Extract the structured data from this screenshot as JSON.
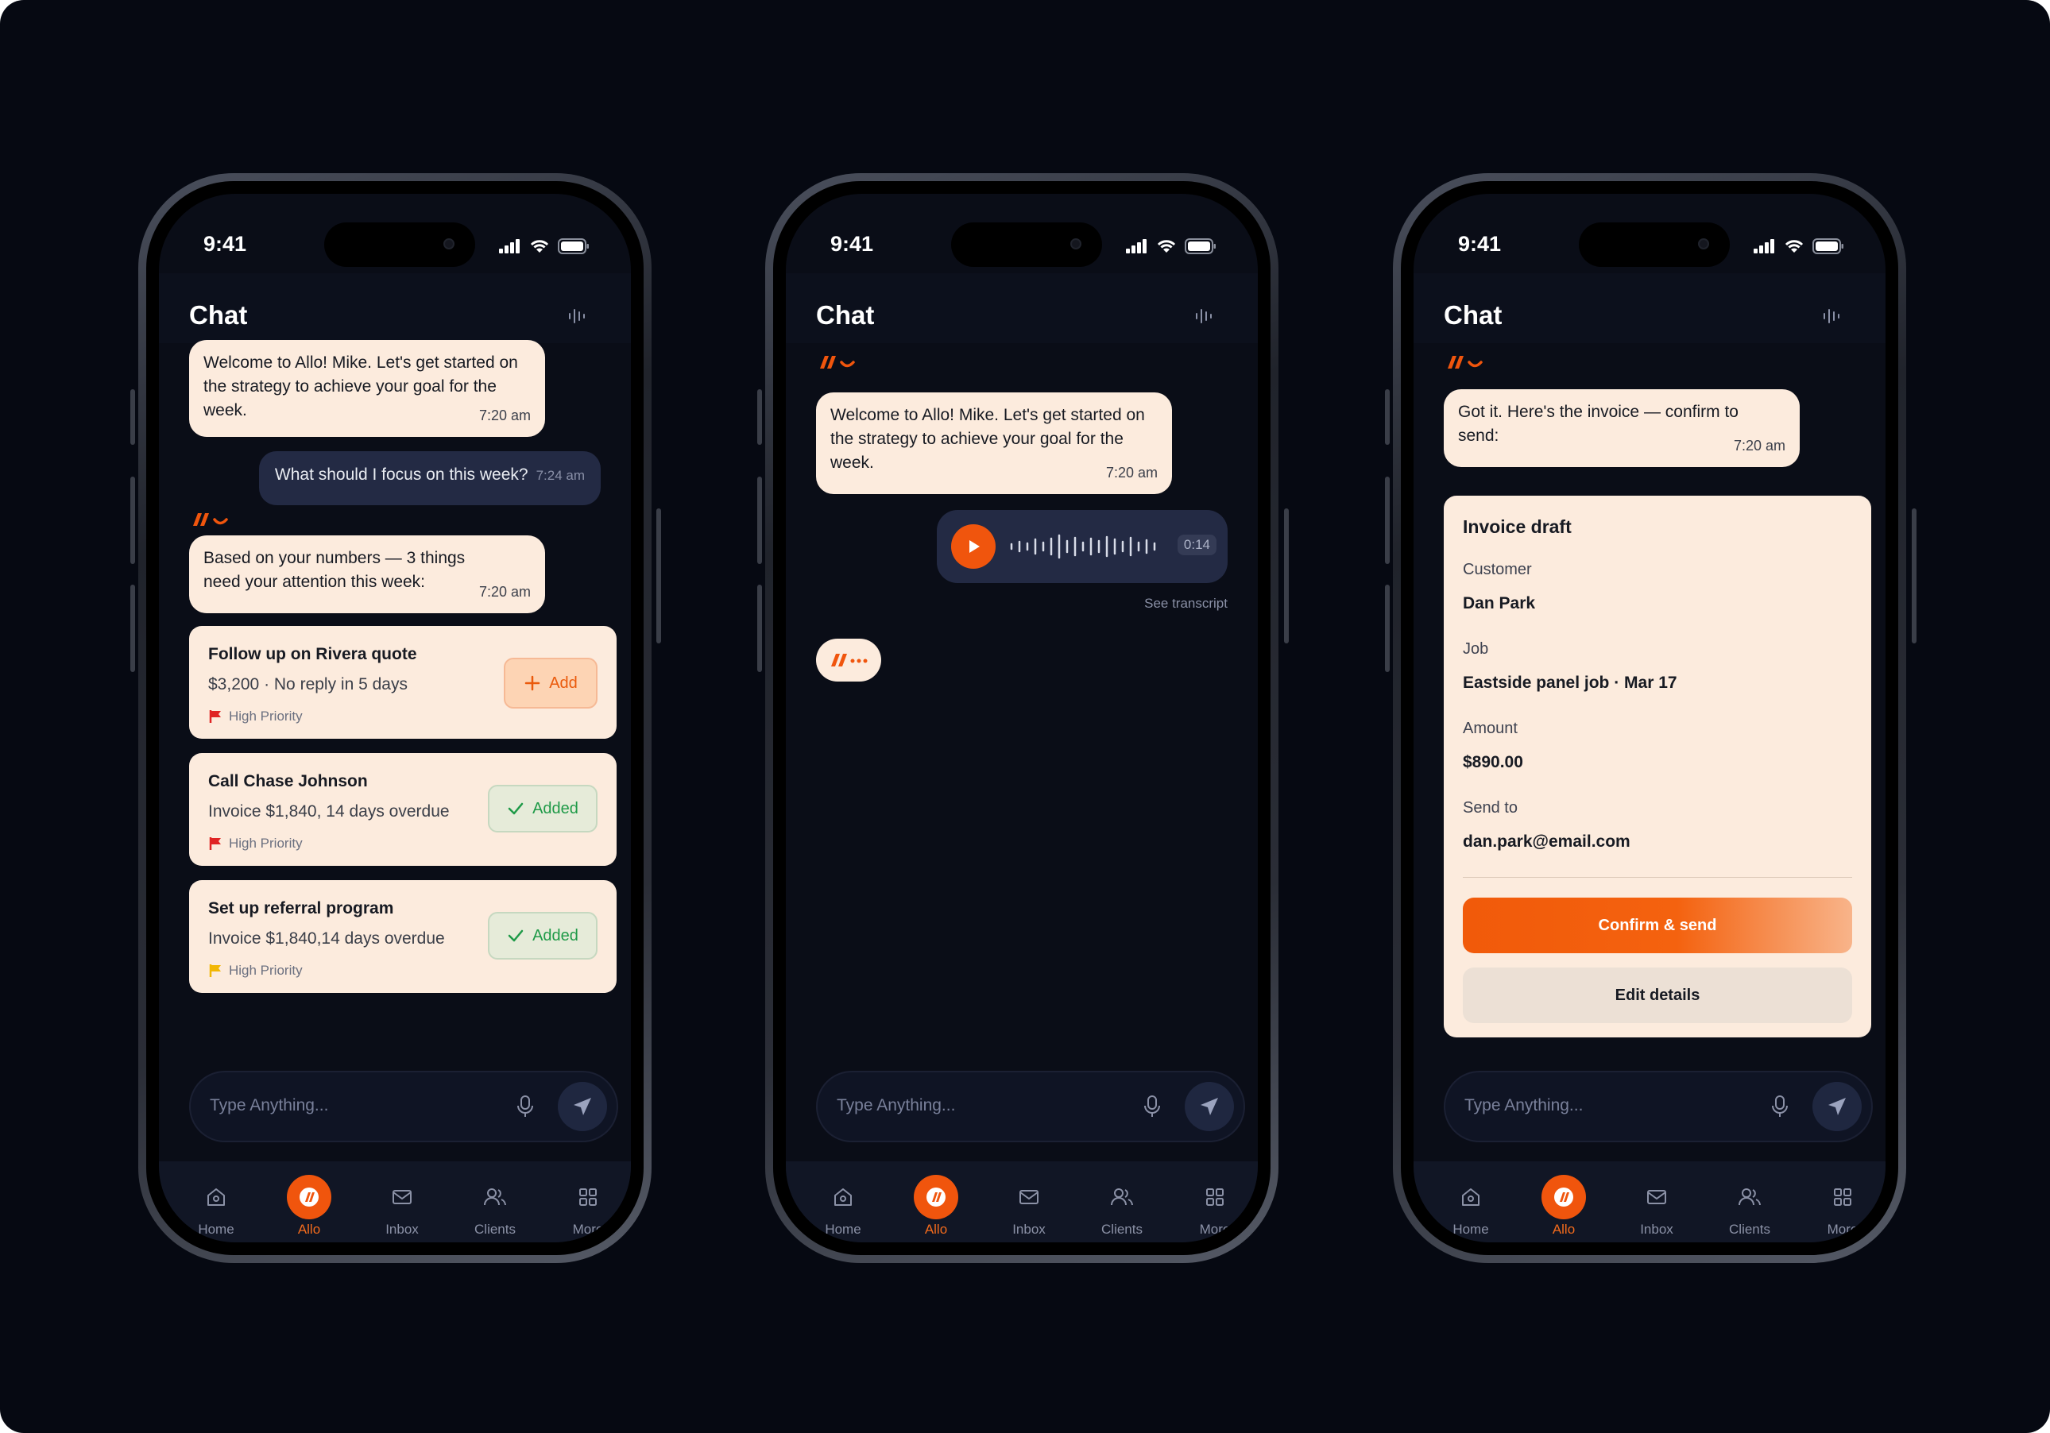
{
  "colors": {
    "accent": "#F0550D",
    "bubble": "#FCEBDD",
    "user_bubble": "#232A44",
    "background": "#060912",
    "added_green": "#1F9A48",
    "flag_red": "#E02424",
    "flag_yellow": "#F2B705"
  },
  "status": {
    "time": "9:41"
  },
  "header": {
    "title": "Chat"
  },
  "input": {
    "placeholder": "Type Anything..."
  },
  "tabs": [
    {
      "label": "Home",
      "icon": "home-icon"
    },
    {
      "label": "Allo",
      "icon": "allo-logo-icon"
    },
    {
      "label": "Inbox",
      "icon": "mail-icon"
    },
    {
      "label": "Clients",
      "icon": "users-icon"
    },
    {
      "label": "More",
      "icon": "grid-icon"
    }
  ],
  "screen1": {
    "welcome": {
      "text": "Welcome to Allo! Mike.  Let's get started on the strategy to achieve your goal for the week.",
      "time": "7:20 am"
    },
    "user_msg": {
      "text": "What should I focus on this week?",
      "time": "7:24 am"
    },
    "reply": {
      "text": "Based on your numbers — 3 things need your attention this week:",
      "time": "7:20 am"
    },
    "tasks": [
      {
        "title": "Follow up on Rivera quote",
        "subtitle": "$3,200 · No reply in 5 days",
        "priority": "High Priority",
        "flag": "red",
        "action": "Add",
        "added": false
      },
      {
        "title": "Call Chase Johnson",
        "subtitle": "Invoice $1,840, 14 days overdue",
        "priority": "High Priority",
        "flag": "red",
        "action": "Added",
        "added": true
      },
      {
        "title": "Set up referral program",
        "subtitle": "Invoice $1,840,14 days overdue",
        "priority": "High Priority",
        "flag": "yellow",
        "action": "Added",
        "added": true
      }
    ]
  },
  "screen2": {
    "welcome": {
      "text": "Welcome to Allo! Mike.  Let's get started on the strategy to achieve your goal for the week.",
      "time": "7:20 am"
    },
    "voice": {
      "duration": "0:14",
      "transcript_link": "See transcript"
    }
  },
  "screen3": {
    "reply": {
      "text": "Got it. Here's the invoice — confirm to send:",
      "time": "7:20 am"
    },
    "invoice": {
      "title": "Invoice draft",
      "customer_label": "Customer",
      "customer": "Dan Park",
      "job_label": "Job",
      "job": "Eastside panel job · Mar 17",
      "amount_label": "Amount",
      "amount": "$890.00",
      "send_label": "Send to",
      "email": "dan.park@email.com",
      "confirm": "Confirm & send",
      "edit": "Edit details"
    }
  }
}
